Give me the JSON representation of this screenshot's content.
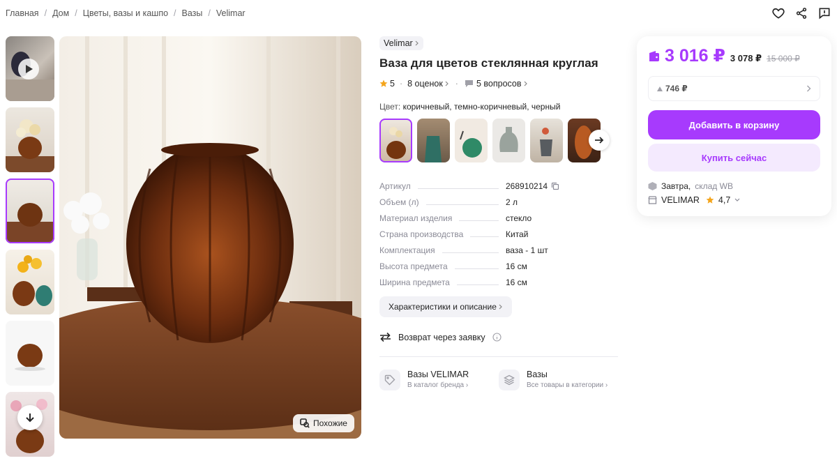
{
  "breadcrumb": [
    "Главная",
    "Дом",
    "Цветы, вазы и кашпо",
    "Вазы",
    "Velimar"
  ],
  "breadcrumb_sep": "/",
  "icons": {
    "favorite": "heart-icon",
    "share": "share-icon",
    "report": "alert-icon",
    "play": "play-icon",
    "scroll_down": "arrow-down-icon",
    "similar": "similar-search-icon",
    "next": "arrow-right-icon"
  },
  "gallery": {
    "similar_label": "Похожие",
    "thumbnail_count": 6,
    "active_thumbnail": 3
  },
  "product": {
    "brand": "Velimar",
    "title": "Ваза для цветов стеклянная круглая",
    "rating": "5",
    "reviews": "8 оценок",
    "questions": "5 вопросов",
    "color_label": "Цвет:",
    "color_value": "коричневый, темно-коричневый, черный",
    "swatch_count": 6
  },
  "specs": [
    {
      "key": "Артикул",
      "value": "268910214"
    },
    {
      "key": "Объем (л)",
      "value": "2 л"
    },
    {
      "key": "Материал изделия",
      "value": "стекло"
    },
    {
      "key": "Страна производства",
      "value": "Китай"
    },
    {
      "key": "Комплектация",
      "value": "ваза - 1 шт"
    },
    {
      "key": "Высота предмета",
      "value": "16 см"
    },
    {
      "key": "Ширина предмета",
      "value": "16 см"
    }
  ],
  "chars_button": "Характеристики и описание",
  "return_text": "Возврат через заявку",
  "links": [
    {
      "title": "Вазы VELIMAR",
      "subtitle": "В каталог бренда"
    },
    {
      "title": "Вазы",
      "subtitle": "Все товары в категории"
    }
  ],
  "price": {
    "current": "3 016 ₽",
    "old1": "3 078 ₽",
    "old2": "15 000 ₽",
    "bonus": "746 ₽",
    "accent": "#a73afd"
  },
  "buttons": {
    "cart": "Добавить в корзину",
    "buy": "Купить сейчас"
  },
  "delivery": {
    "day": "Завтра,",
    "warehouse": "склад WB"
  },
  "seller": {
    "name": "VELIMAR",
    "rating": "4,7"
  }
}
